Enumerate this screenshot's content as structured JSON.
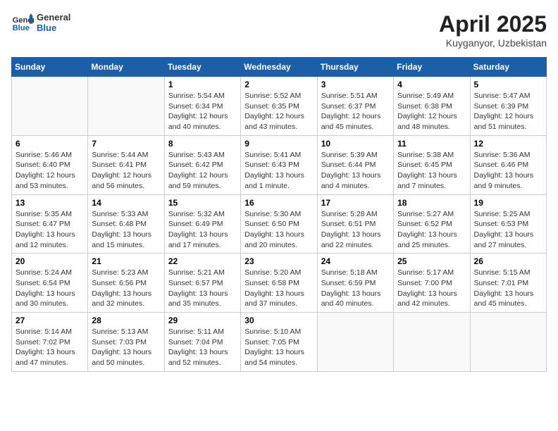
{
  "header": {
    "logo_general": "General",
    "logo_blue": "Blue",
    "month_title": "April 2025",
    "location": "Kuyganyor, Uzbekistan"
  },
  "weekdays": [
    "Sunday",
    "Monday",
    "Tuesday",
    "Wednesday",
    "Thursday",
    "Friday",
    "Saturday"
  ],
  "weeks": [
    [
      {
        "day": "",
        "info": ""
      },
      {
        "day": "",
        "info": ""
      },
      {
        "day": "1",
        "info": "Sunrise: 5:54 AM\nSunset: 6:34 PM\nDaylight: 12 hours\nand 40 minutes."
      },
      {
        "day": "2",
        "info": "Sunrise: 5:52 AM\nSunset: 6:35 PM\nDaylight: 12 hours\nand 43 minutes."
      },
      {
        "day": "3",
        "info": "Sunrise: 5:51 AM\nSunset: 6:37 PM\nDaylight: 12 hours\nand 45 minutes."
      },
      {
        "day": "4",
        "info": "Sunrise: 5:49 AM\nSunset: 6:38 PM\nDaylight: 12 hours\nand 48 minutes."
      },
      {
        "day": "5",
        "info": "Sunrise: 5:47 AM\nSunset: 6:39 PM\nDaylight: 12 hours\nand 51 minutes."
      }
    ],
    [
      {
        "day": "6",
        "info": "Sunrise: 5:46 AM\nSunset: 6:40 PM\nDaylight: 12 hours\nand 53 minutes."
      },
      {
        "day": "7",
        "info": "Sunrise: 5:44 AM\nSunset: 6:41 PM\nDaylight: 12 hours\nand 56 minutes."
      },
      {
        "day": "8",
        "info": "Sunrise: 5:43 AM\nSunset: 6:42 PM\nDaylight: 12 hours\nand 59 minutes."
      },
      {
        "day": "9",
        "info": "Sunrise: 5:41 AM\nSunset: 6:43 PM\nDaylight: 13 hours\nand 1 minute."
      },
      {
        "day": "10",
        "info": "Sunrise: 5:39 AM\nSunset: 6:44 PM\nDaylight: 13 hours\nand 4 minutes."
      },
      {
        "day": "11",
        "info": "Sunrise: 5:38 AM\nSunset: 6:45 PM\nDaylight: 13 hours\nand 7 minutes."
      },
      {
        "day": "12",
        "info": "Sunrise: 5:36 AM\nSunset: 6:46 PM\nDaylight: 13 hours\nand 9 minutes."
      }
    ],
    [
      {
        "day": "13",
        "info": "Sunrise: 5:35 AM\nSunset: 6:47 PM\nDaylight: 13 hours\nand 12 minutes."
      },
      {
        "day": "14",
        "info": "Sunrise: 5:33 AM\nSunset: 6:48 PM\nDaylight: 13 hours\nand 15 minutes."
      },
      {
        "day": "15",
        "info": "Sunrise: 5:32 AM\nSunset: 6:49 PM\nDaylight: 13 hours\nand 17 minutes."
      },
      {
        "day": "16",
        "info": "Sunrise: 5:30 AM\nSunset: 6:50 PM\nDaylight: 13 hours\nand 20 minutes."
      },
      {
        "day": "17",
        "info": "Sunrise: 5:28 AM\nSunset: 6:51 PM\nDaylight: 13 hours\nand 22 minutes."
      },
      {
        "day": "18",
        "info": "Sunrise: 5:27 AM\nSunset: 6:52 PM\nDaylight: 13 hours\nand 25 minutes."
      },
      {
        "day": "19",
        "info": "Sunrise: 5:25 AM\nSunset: 6:53 PM\nDaylight: 13 hours\nand 27 minutes."
      }
    ],
    [
      {
        "day": "20",
        "info": "Sunrise: 5:24 AM\nSunset: 6:54 PM\nDaylight: 13 hours\nand 30 minutes."
      },
      {
        "day": "21",
        "info": "Sunrise: 5:23 AM\nSunset: 6:56 PM\nDaylight: 13 hours\nand 32 minutes."
      },
      {
        "day": "22",
        "info": "Sunrise: 5:21 AM\nSunset: 6:57 PM\nDaylight: 13 hours\nand 35 minutes."
      },
      {
        "day": "23",
        "info": "Sunrise: 5:20 AM\nSunset: 6:58 PM\nDaylight: 13 hours\nand 37 minutes."
      },
      {
        "day": "24",
        "info": "Sunrise: 5:18 AM\nSunset: 6:59 PM\nDaylight: 13 hours\nand 40 minutes."
      },
      {
        "day": "25",
        "info": "Sunrise: 5:17 AM\nSunset: 7:00 PM\nDaylight: 13 hours\nand 42 minutes."
      },
      {
        "day": "26",
        "info": "Sunrise: 5:15 AM\nSunset: 7:01 PM\nDaylight: 13 hours\nand 45 minutes."
      }
    ],
    [
      {
        "day": "27",
        "info": "Sunrise: 5:14 AM\nSunset: 7:02 PM\nDaylight: 13 hours\nand 47 minutes."
      },
      {
        "day": "28",
        "info": "Sunrise: 5:13 AM\nSunset: 7:03 PM\nDaylight: 13 hours\nand 50 minutes."
      },
      {
        "day": "29",
        "info": "Sunrise: 5:11 AM\nSunset: 7:04 PM\nDaylight: 13 hours\nand 52 minutes."
      },
      {
        "day": "30",
        "info": "Sunrise: 5:10 AM\nSunset: 7:05 PM\nDaylight: 13 hours\nand 54 minutes."
      },
      {
        "day": "",
        "info": ""
      },
      {
        "day": "",
        "info": ""
      },
      {
        "day": "",
        "info": ""
      }
    ]
  ]
}
